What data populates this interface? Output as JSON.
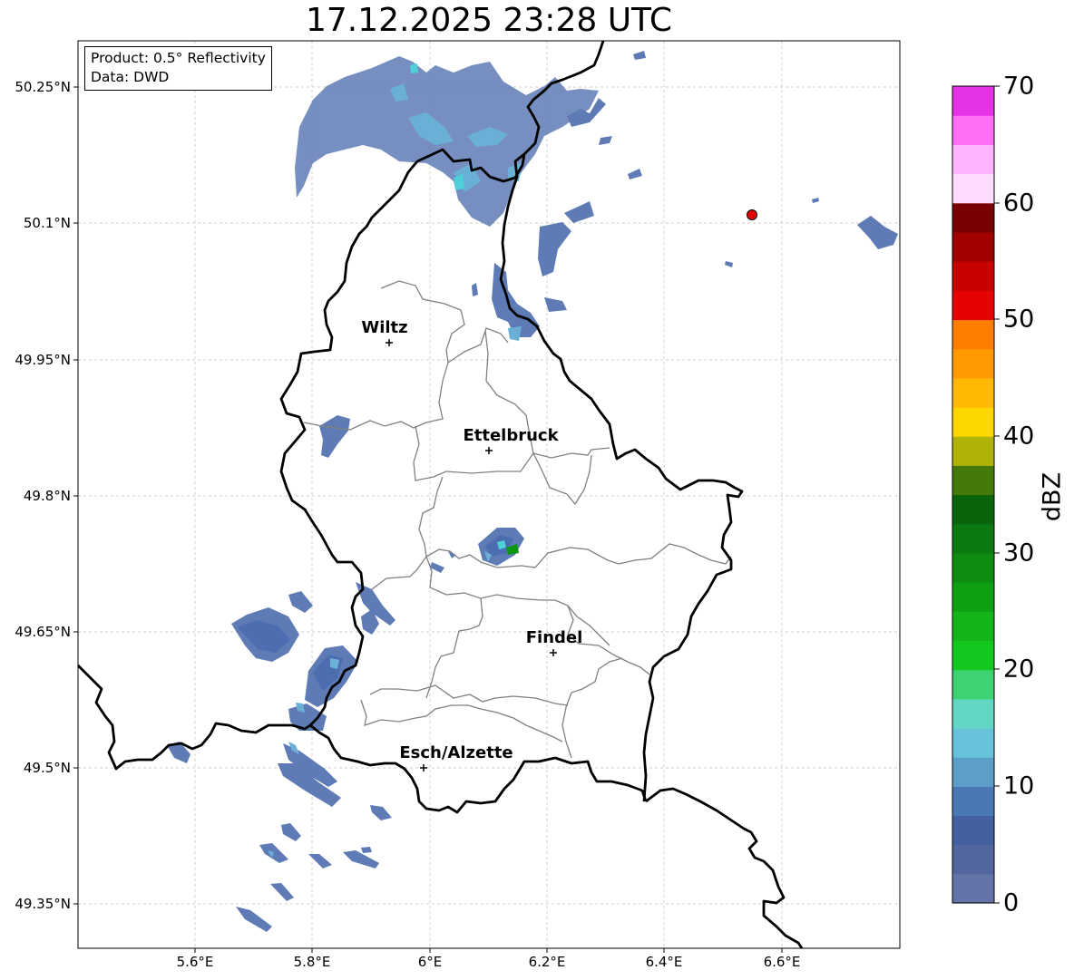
{
  "title": "17.12.2025 23:28 UTC",
  "info": {
    "product": "Product: 0.5° Reflectivity",
    "data": "Data: DWD"
  },
  "lat_ticks": [
    "50.25°N",
    "50.1°N",
    "49.95°N",
    "49.8°N",
    "49.65°N",
    "49.5°N",
    "49.35°N"
  ],
  "lon_ticks": [
    "5.6°E",
    "5.8°E",
    "6°E",
    "6.2°E",
    "6.4°E",
    "6.6°E"
  ],
  "cities": [
    {
      "name": "Wiltz",
      "lat": 49.966,
      "lon": 5.932
    },
    {
      "name": "Ettelbruck",
      "lat": 49.848,
      "lon": 6.104
    },
    {
      "name": "Findel",
      "lat": 49.626,
      "lon": 6.212
    },
    {
      "name": "Esch/Alzette",
      "lat": 49.498,
      "lon": 5.991
    }
  ],
  "radar_site": {
    "color": "#e00000",
    "lat": 50.109,
    "lon": 6.548
  },
  "colorbar": {
    "label": "dBZ",
    "ticks": [
      "0",
      "10",
      "20",
      "30",
      "40",
      "50",
      "60",
      "70"
    ],
    "colors": [
      "#6474a8",
      "#5466a0",
      "#4360a0",
      "#4a78b4",
      "#5b9fc8",
      "#68c2dc",
      "#62d8c4",
      "#3fd272",
      "#14c820",
      "#14b41a",
      "#10a014",
      "#0e8c12",
      "#0c7810",
      "#09640c",
      "#457a0a",
      "#afb209",
      "#ffd700",
      "#ffb900",
      "#ff9a00",
      "#ff7d00",
      "#e60000",
      "#c80000",
      "#a00000",
      "#780000",
      "#ffdcff",
      "#ffb4ff",
      "#ff6ef5",
      "#e632e6"
    ]
  },
  "reflectivity_colors": {
    "light": "#5f7bb5",
    "mid": "#4c6db0",
    "bright": "#6ab0d6",
    "cyan": "#4dd0d8",
    "green": "#0c9614"
  }
}
